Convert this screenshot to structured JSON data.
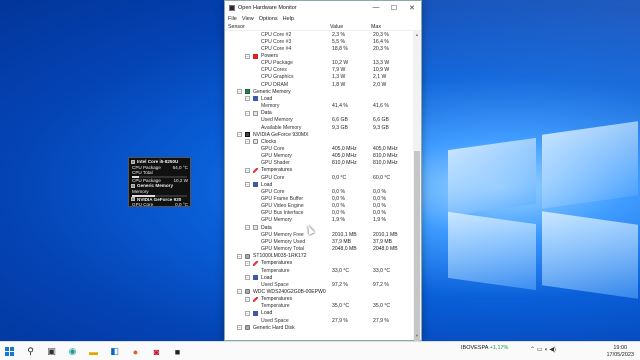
{
  "window": {
    "title": "Open Hardware Monitor",
    "menu": [
      "File",
      "View",
      "Options",
      "Help"
    ],
    "columns": {
      "sensor": "Sensor",
      "value": "Value",
      "max": "Max"
    },
    "controls": {
      "minimize": "—",
      "maximize": "☐",
      "close": "✕"
    }
  },
  "tree": [
    {
      "depth": 4,
      "type": "leaf",
      "label": "CPU Core #2",
      "value": "2,3 %",
      "max": "20,3 %"
    },
    {
      "depth": 4,
      "type": "leaf",
      "label": "CPU Core #3",
      "value": "5,5 %",
      "max": "16,4 %"
    },
    {
      "depth": 4,
      "type": "leaf",
      "label": "CPU Core #4",
      "value": "18,8 %",
      "max": "20,3 %"
    },
    {
      "depth": 3,
      "type": "group",
      "icon": "power-icon",
      "label": "Powers"
    },
    {
      "depth": 4,
      "type": "leaf",
      "label": "CPU Package",
      "value": "10,2 W",
      "max": "13,3 W"
    },
    {
      "depth": 4,
      "type": "leaf",
      "label": "CPU Cores",
      "value": "7,9 W",
      "max": "10,9 W"
    },
    {
      "depth": 4,
      "type": "leaf",
      "label": "CPU Graphics",
      "value": "1,3 W",
      "max": "2,1 W"
    },
    {
      "depth": 4,
      "type": "leaf",
      "label": "CPU DRAM",
      "value": "1,8 W",
      "max": "2,0 W"
    },
    {
      "depth": 2,
      "type": "hardware",
      "icon": "memory-icon",
      "label": "Generic Memory"
    },
    {
      "depth": 3,
      "type": "group",
      "icon": "load-icon",
      "label": "Load"
    },
    {
      "depth": 4,
      "type": "leaf",
      "label": "Memory",
      "value": "41,4 %",
      "max": "41,6 %"
    },
    {
      "depth": 3,
      "type": "group",
      "icon": "data-icon",
      "label": "Data"
    },
    {
      "depth": 4,
      "type": "leaf",
      "label": "Used Memory",
      "value": "6,6 GB",
      "max": "6,6 GB"
    },
    {
      "depth": 4,
      "type": "leaf",
      "label": "Available Memory",
      "value": "9,3 GB",
      "max": "9,3 GB"
    },
    {
      "depth": 2,
      "type": "hardware",
      "icon": "gpu-icon",
      "label": "NVIDIA GeForce 930MX"
    },
    {
      "depth": 3,
      "type": "group",
      "icon": "clock-icon",
      "label": "Clocks"
    },
    {
      "depth": 4,
      "type": "leaf",
      "label": "GPU Core",
      "value": "405,0 MHz",
      "max": "405,0 MHz"
    },
    {
      "depth": 4,
      "type": "leaf",
      "label": "GPU Memory",
      "value": "405,0 MHz",
      "max": "810,0 MHz"
    },
    {
      "depth": 4,
      "type": "leaf",
      "label": "GPU Shader",
      "value": "810,0 MHz",
      "max": "810,0 MHz"
    },
    {
      "depth": 3,
      "type": "group",
      "icon": "temperature-icon",
      "label": "Temperatures"
    },
    {
      "depth": 4,
      "type": "leaf",
      "label": "GPU Core",
      "value": "0,0 °C",
      "max": "60,0 °C"
    },
    {
      "depth": 3,
      "type": "group",
      "icon": "load-icon",
      "label": "Load"
    },
    {
      "depth": 4,
      "type": "leaf",
      "label": "GPU Core",
      "value": "0,0 %",
      "max": "0,0 %"
    },
    {
      "depth": 4,
      "type": "leaf",
      "label": "GPU Frame Buffer",
      "value": "0,0 %",
      "max": "0,0 %"
    },
    {
      "depth": 4,
      "type": "leaf",
      "label": "GPU Video Engine",
      "value": "0,0 %",
      "max": "0,0 %"
    },
    {
      "depth": 4,
      "type": "leaf",
      "label": "GPU Bus Interface",
      "value": "0,0 %",
      "max": "0,0 %"
    },
    {
      "depth": 4,
      "type": "leaf",
      "label": "GPU Memory",
      "value": "1,9 %",
      "max": "1,9 %"
    },
    {
      "depth": 3,
      "type": "group",
      "icon": "data-icon",
      "label": "Data"
    },
    {
      "depth": 4,
      "type": "leaf",
      "label": "GPU Memory Free",
      "value": "2010,1 MB",
      "max": "2010,1 MB"
    },
    {
      "depth": 4,
      "type": "leaf",
      "label": "GPU Memory Used",
      "value": "37,9 MB",
      "max": "37,9 MB"
    },
    {
      "depth": 4,
      "type": "leaf",
      "label": "GPU Memory Total",
      "value": "2048,0 MB",
      "max": "2048,0 MB"
    },
    {
      "depth": 2,
      "type": "hardware",
      "icon": "disk-icon",
      "label": "ST1000LM035-1RK172"
    },
    {
      "depth": 3,
      "type": "group",
      "icon": "temperature-icon",
      "label": "Temperatures"
    },
    {
      "depth": 4,
      "type": "leaf",
      "label": "Temperature",
      "value": "33,0 °C",
      "max": "33,0 °C"
    },
    {
      "depth": 3,
      "type": "group",
      "icon": "load-icon",
      "label": "Load"
    },
    {
      "depth": 4,
      "type": "leaf",
      "label": "Used Space",
      "value": "97,2 %",
      "max": "97,2 %"
    },
    {
      "depth": 2,
      "type": "hardware",
      "icon": "disk-icon",
      "label": "WDC WDS240G2G0B-00EPW0"
    },
    {
      "depth": 3,
      "type": "group",
      "icon": "temperature-icon",
      "label": "Temperatures"
    },
    {
      "depth": 4,
      "type": "leaf",
      "label": "Temperature",
      "value": "35,0 °C",
      "max": "35,0 °C"
    },
    {
      "depth": 3,
      "type": "group",
      "icon": "load-icon",
      "label": "Load"
    },
    {
      "depth": 4,
      "type": "leaf",
      "label": "Used Space",
      "value": "27,9 %",
      "max": "27,9 %"
    },
    {
      "depth": 2,
      "type": "hardware",
      "icon": "disk-icon",
      "label": "Generic Hard Disk"
    }
  ],
  "gadget": {
    "cpu_title": "Intel Core i5-8250U",
    "cpu_rows": [
      {
        "label": "CPU Package",
        "value": "64,0 °C"
      },
      {
        "label": "CPU Total",
        "value": ""
      },
      {
        "label": "CPU Package",
        "value": "10,2 W"
      }
    ],
    "cpu_total_fraction": 0.12,
    "mem_title": "Generic Memory",
    "mem_label": "Memory",
    "mem_fraction": 0.41,
    "gpu_title": "NVIDIA GeForce 930",
    "gpu_label": "GPU Core",
    "gpu_value": "0,0 °C"
  },
  "taskbar": {
    "ticker_name": "IBOVESPA",
    "ticker_change": "+1,17%",
    "time": "19:00",
    "date": "17/05/2023"
  },
  "colors": {
    "accent": "#1478d4",
    "ticker_positive": "#1a9c3a",
    "temp_red": "#e33",
    "load_blue": "#3b5ba8"
  }
}
